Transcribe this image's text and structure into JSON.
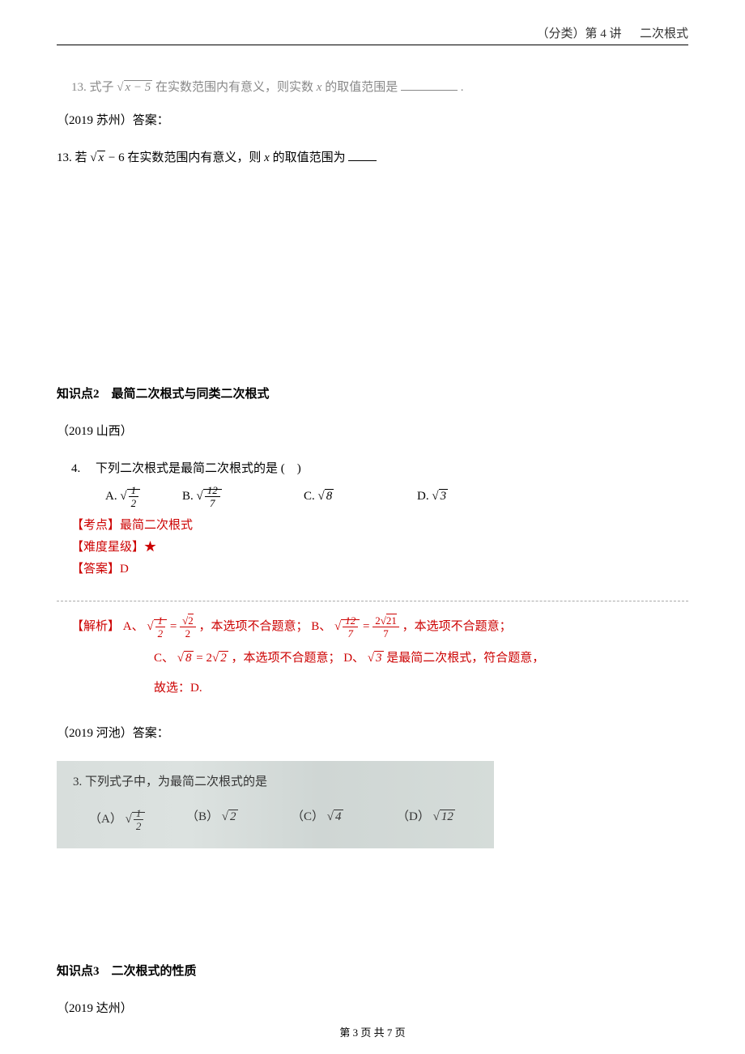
{
  "header": {
    "category": "（分类）第 4 讲",
    "title": "二次根式"
  },
  "q13a": {
    "num": "13.",
    "t1": "式子",
    "expr_pre": "x − 5",
    "t2": "在实数范围内有意义，则实数",
    "var": "x",
    "t3": "的取值范围是",
    "end": "."
  },
  "src_suzhou": "（2019 苏州）答案：",
  "q13b": {
    "num": "13.",
    "t1": "若",
    "sqrt": "x",
    "minus": " − 6",
    "t2": "在实数范围内有意义，则",
    "var": "x",
    "t3": "的取值范围为"
  },
  "section2_title": "知识点2　最简二次根式与同类二次根式",
  "src_shanxi": "（2019 山西）",
  "q4": {
    "num": "4.",
    "stem": "下列二次根式是最简二次根式的是 (　)",
    "A": "A.",
    "A_num": "1",
    "A_den": "2",
    "B": "B.",
    "B_num": "12",
    "B_den": "7",
    "C": "C.",
    "C_arg": "8",
    "D": "D.",
    "D_arg": "3",
    "kaodian_label": "【考点】",
    "kaodian": "最简二次根式",
    "nandu_label": "【难度星级】",
    "nandu": "★",
    "daan_label": "【答案】",
    "daan": "D",
    "jiexi_label": "【解析】",
    "jiexi_A1": "A、",
    "eqA_l_num": "1",
    "eqA_l_den": "2",
    "eqA_r_num": "2",
    "eqA_r_den": "2",
    "jiexi_A2": "，本选项不合题意；",
    "jiexi_B1": "B、",
    "eqB_l_num": "12",
    "eqB_l_den": "7",
    "eqB_r_num": "21",
    "eqB_r_den": "7",
    "eqB_r_coef": "2",
    "jiexi_B2": "，本选项不合题意；",
    "jiexi_C1": "C、",
    "eqC_l": "8",
    "eqC_r": "2",
    "eqC_coef": "2",
    "jiexi_C2": "，本选项不合题意；",
    "jiexi_D1": "D、",
    "eqD": "3",
    "jiexi_D2": " 是最简二次根式，符合题意，",
    "jiexi_end": "故选：D."
  },
  "src_hechi": "（2019 河池）答案：",
  "q3": {
    "num": "3.",
    "stem": "下列式子中，为最简二次根式的是",
    "A": "（A）",
    "A_num": "1",
    "A_den": "2",
    "B": "（B）",
    "B_arg": "2",
    "C": "（C）",
    "C_arg": "4",
    "D": "（D）",
    "D_arg": "12"
  },
  "section3_title": "知识点3　二次根式的性质",
  "src_dazhou": "（2019 达州）",
  "footer": {
    "pre": "第 ",
    "cur": "3",
    "mid": " 页 共 ",
    "total": "7",
    "suf": " 页"
  }
}
